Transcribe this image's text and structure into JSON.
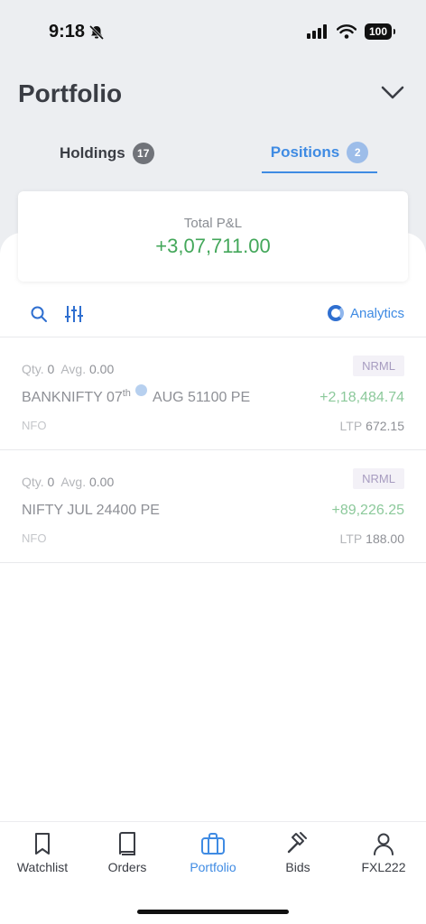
{
  "status_bar": {
    "time": "9:18",
    "battery": "100"
  },
  "header": {
    "title": "Portfolio"
  },
  "tabs": [
    {
      "label": "Holdings",
      "count": "17",
      "active": false
    },
    {
      "label": "Positions",
      "count": "2",
      "active": true
    }
  ],
  "summary": {
    "label": "Total P&L",
    "value": "+3,07,711.00"
  },
  "toolbar": {
    "analytics_label": "Analytics"
  },
  "positions": [
    {
      "qty_label": "Qty.",
      "qty": "0",
      "avg_label": "Avg.",
      "avg": "0.00",
      "product": "NRML",
      "symbol_pre": "BANKNIFTY 07",
      "symbol_sup": "th",
      "symbol_post": "AUG 51100 PE",
      "pnl": "+2,18,484.74",
      "exchange": "NFO",
      "ltp_label": "LTP",
      "ltp": "672.15"
    },
    {
      "qty_label": "Qty.",
      "qty": "0",
      "avg_label": "Avg.",
      "avg": "0.00",
      "product": "NRML",
      "symbol": "NIFTY JUL 24400 PE",
      "pnl": "+89,226.25",
      "exchange": "NFO",
      "ltp_label": "LTP",
      "ltp": "188.00"
    }
  ],
  "bottom_nav": [
    {
      "label": "Watchlist",
      "icon": "bookmark-icon"
    },
    {
      "label": "Orders",
      "icon": "book-icon"
    },
    {
      "label": "Portfolio",
      "icon": "briefcase-icon",
      "active": true
    },
    {
      "label": "Bids",
      "icon": "gavel-icon"
    },
    {
      "label": "FXL222",
      "icon": "user-icon"
    }
  ],
  "colors": {
    "accent": "#3f8be3",
    "profit": "#43a75a",
    "profit_light": "#8cc99b"
  }
}
